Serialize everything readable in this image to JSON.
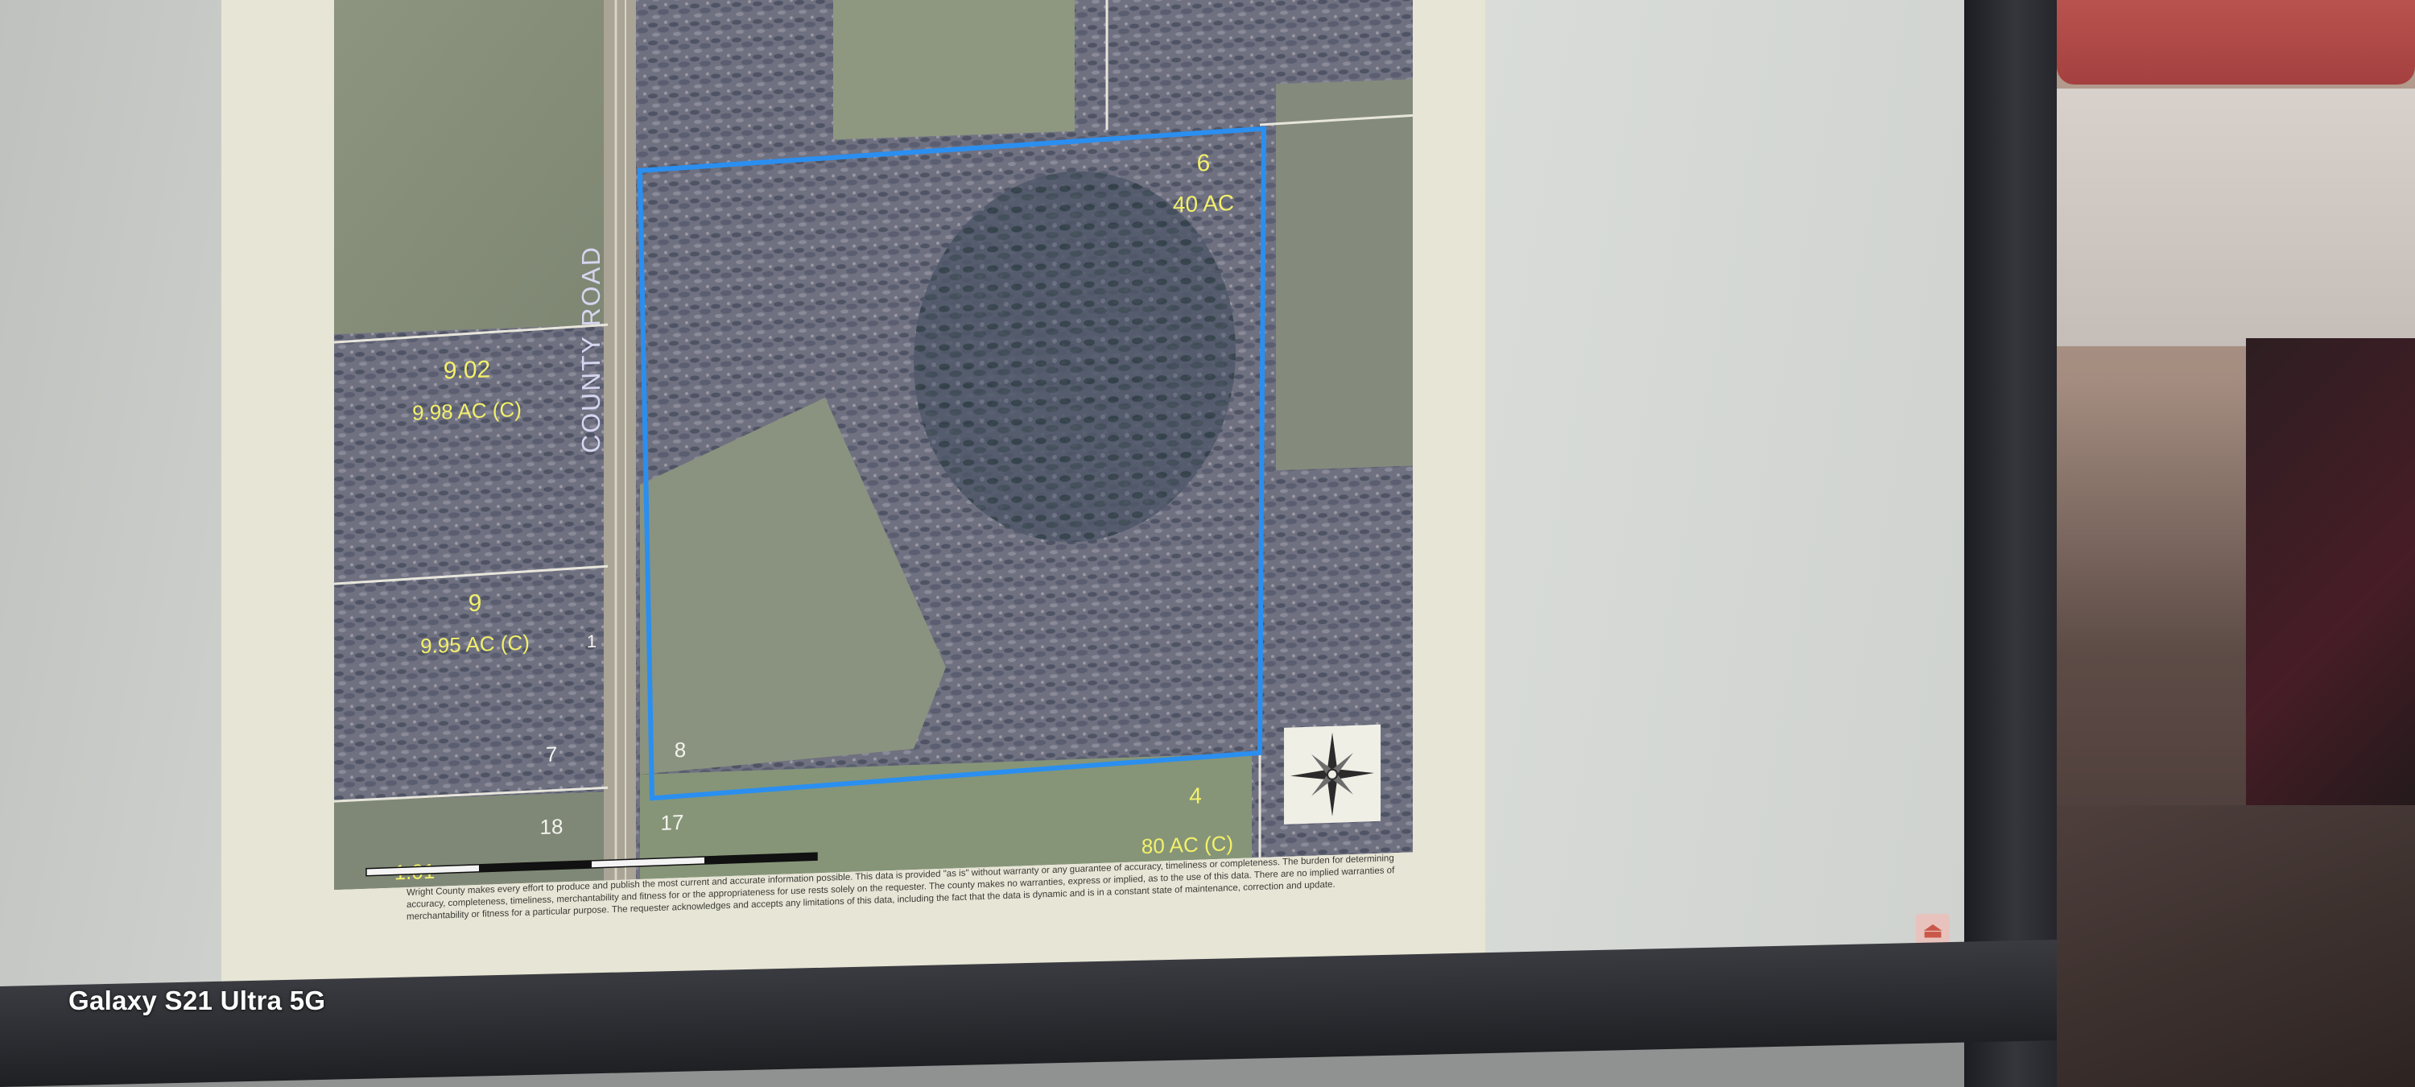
{
  "map": {
    "road_label": "COUNTY ROAD",
    "parcels": [
      {
        "number": "6",
        "acres": "40 AC"
      },
      {
        "number": "9.02",
        "acres": "9.98 AC (C)"
      },
      {
        "number": "9",
        "acres": "9.95 AC (C)"
      },
      {
        "number": "4",
        "acres": "80 AC (C)"
      },
      {
        "number": "1.01",
        "acres": ""
      }
    ],
    "parcel_numbers": [
      "8",
      "7",
      "17",
      "18",
      "1"
    ],
    "highlight_color": "#2a8ff0",
    "label_color": "#f3f06a",
    "compass_icon": "compass-rose-icon",
    "scale_bar_icon": "scale-bar-icon"
  },
  "disclaimer": "Wright County makes every effort to produce and publish the most current and accurate information possible. This data is provided \"as is\" without warranty or any guarantee of accuracy, timeliness or completeness. The burden for determining accuracy, completeness, timeliness, merchantability and fitness for or the appropriateness for use rests solely on the requester. The county makes no warranties, express or implied, as to the use of this data. There are no implied warranties of merchantability or fitness for a particular purpose. The requester acknowledges and accepts any limitations of this data, including the fact that the data is dynamic and is in a constant state of maintenance, correction and update.",
  "viewer": {
    "pdf_icon": "acrobat-pdf-icon"
  },
  "camera_watermark": "Galaxy S21 Ultra 5G"
}
